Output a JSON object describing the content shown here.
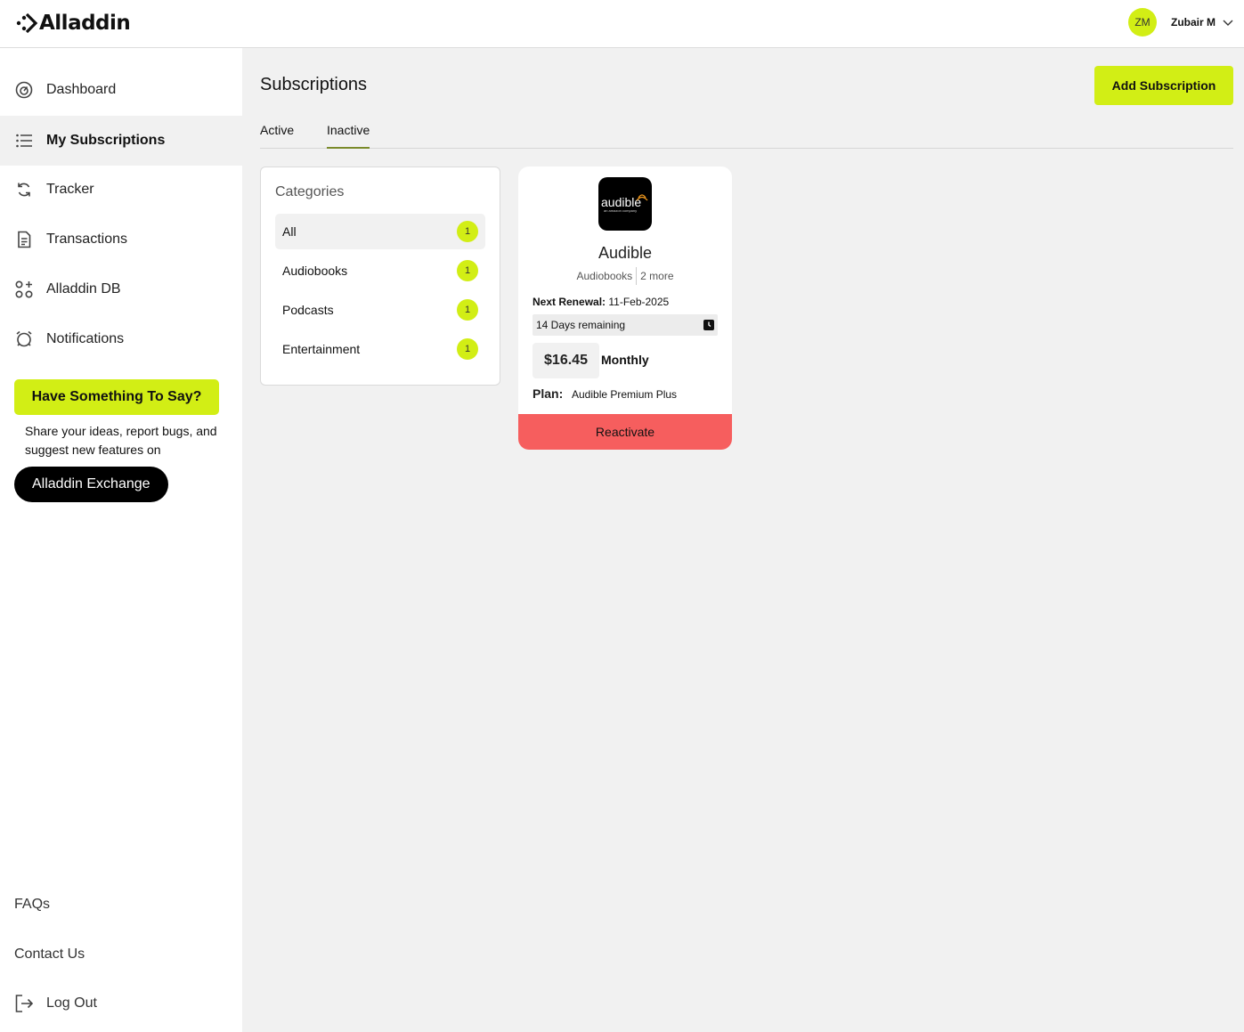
{
  "app": {
    "logo_text": "Alladdin"
  },
  "user": {
    "initials": "ZM",
    "name": "Zubair M"
  },
  "sidebar": {
    "items": [
      {
        "label": "Dashboard",
        "icon": "gauge-icon"
      },
      {
        "label": "My Subscriptions",
        "icon": "list-icon",
        "active": true
      },
      {
        "label": "Tracker",
        "icon": "refresh-icon"
      },
      {
        "label": "Transactions",
        "icon": "document-icon"
      },
      {
        "label": "Alladdin DB",
        "icon": "grid-plus-icon"
      },
      {
        "label": "Notifications",
        "icon": "bell-icon"
      }
    ],
    "feedback": {
      "button_label": "Have Something To Say?",
      "text": "Share your ideas, report bugs, and suggest new features on",
      "exchange_label": "Alladdin Exchange"
    },
    "footer": {
      "faqs": "FAQs",
      "contact": "Contact Us",
      "logout": "Log Out"
    }
  },
  "main": {
    "title": "Subscriptions",
    "add_button": "Add Subscription",
    "tabs": [
      {
        "label": "Active"
      },
      {
        "label": "Inactive",
        "active": true
      }
    ],
    "categories": {
      "title": "Categories",
      "items": [
        {
          "label": "All",
          "count": "1"
        },
        {
          "label": "Audiobooks",
          "count": "1"
        },
        {
          "label": "Podcasts",
          "count": "1"
        },
        {
          "label": "Entertainment",
          "count": "1"
        }
      ]
    },
    "card": {
      "logo_text": "audible",
      "logo_subtext": "an amazon company",
      "name": "Audible",
      "category": "Audiobooks",
      "more": "2 more",
      "renewal_label": "Next Renewal:",
      "renewal_date": "11-Feb-2025",
      "remaining": "14 Days remaining",
      "price": "$16.45",
      "period": "Monthly",
      "plan_label": "Plan:",
      "plan_value": "Audible Premium Plus",
      "action": "Reactivate"
    }
  },
  "colors": {
    "accent": "#d2ee15",
    "danger": "#f65e5e",
    "background": "#f1f1f1"
  }
}
